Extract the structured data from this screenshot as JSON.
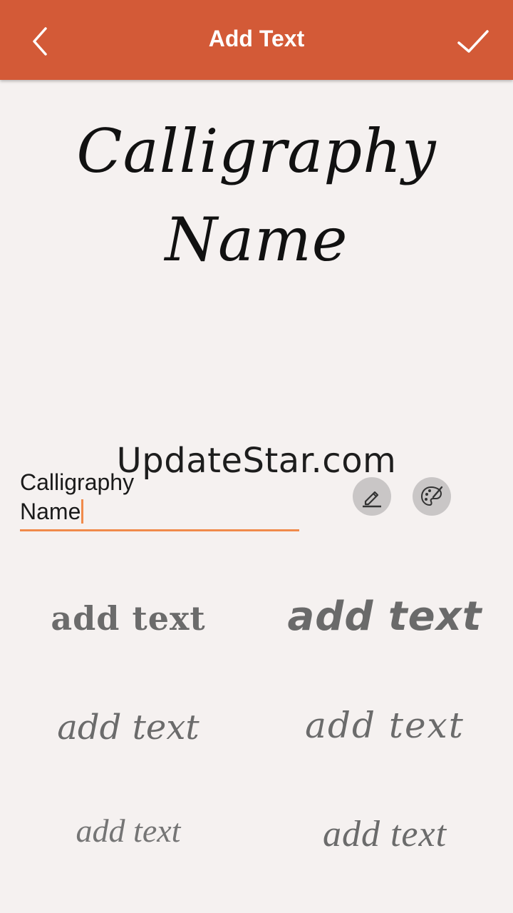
{
  "appbar": {
    "title": "Add Text",
    "back_icon": "chevron-left-icon",
    "done_icon": "checkmark-icon",
    "color": "#d35a37"
  },
  "preview": {
    "line1": "Calligraphy",
    "line2": "Name"
  },
  "watermark": "UpdateStar.com",
  "input": {
    "value": "Calligraphy\nName",
    "accent": "#f08a4b"
  },
  "tools": {
    "edit_icon": "pencil-icon",
    "palette_icon": "palette-icon"
  },
  "font_samples": [
    {
      "label": "add text"
    },
    {
      "label": "add text"
    },
    {
      "label": "add text"
    },
    {
      "label": "add text"
    },
    {
      "label": "add text"
    },
    {
      "label": "add text"
    }
  ]
}
